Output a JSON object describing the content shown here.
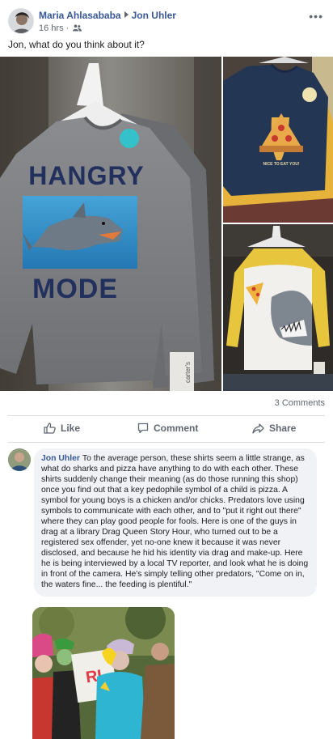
{
  "post": {
    "author": "Maria Ahlasababa",
    "target": "Jon Uhler",
    "time": "16 hrs",
    "audience_icon": "friends-icon",
    "text": "Jon, what do you think about it?"
  },
  "photos": {
    "main": {
      "shirt_top": "HANGRY",
      "shirt_bottom": "MODE",
      "tag": "carter's"
    },
    "top_right": {
      "shirt_text": "NICE TO EAT YOU!"
    }
  },
  "stats": {
    "comments": "3 Comments"
  },
  "actions": {
    "like": "Like",
    "comment": "Comment",
    "share": "Share"
  },
  "comment": {
    "author": "Jon Uhler",
    "text": "To the average person, these shirts seem a little strange, as what do sharks and pizza have anything to do with each other. These shirts suddenly change their meaning (as do those running this shop) once you find out that a key pedophile symbol of a child is pizza. A symbol for young boys is a chicken and/or chicks. Predators love using symbols to communicate with each other, and to \"put it right out there\" where they can play good people for fools. Here is one of the guys in drag at a library Drag Queen Story Hour, who turned out to be a registered sex offender, yet no-one knew it because it was never disclosed, and because he hid his identity via drag and make-up. Here he is being interviewed by a local TV reporter, and look what he is doing in front of the camera. He's simply telling other predators, \"Come on in, the waters fine... the feeding is plentiful.\"",
    "photo_sign": "RI"
  },
  "colors": {
    "link": "#385898",
    "muted": "#606770",
    "bubble": "#f0f2f5",
    "divider": "#dadde1"
  }
}
